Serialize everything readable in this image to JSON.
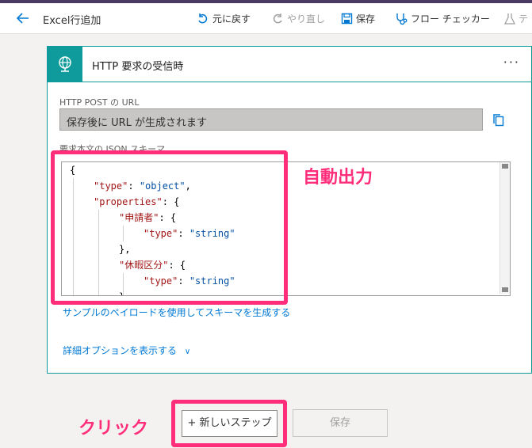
{
  "header": {
    "title": "Excel行追加",
    "undo_label": "元に戻す",
    "redo_label": "やり直し",
    "save_label": "保存",
    "checker_label": "フロー チェッカー",
    "test_label": "テ"
  },
  "card": {
    "title": "HTTP 要求の受信時",
    "more_label": "···",
    "url_label": "HTTP POST の URL",
    "url_value": "保存後に URL が生成されます",
    "schema_label": "要求本文の JSON スキーマ",
    "sample_link": "サンプルのペイロードを使用してスキーマを生成する",
    "advanced_link": "詳細オプションを表示する",
    "advanced_chevron": "∨"
  },
  "schema_code": {
    "l1": "{",
    "l2_key": "\"type\"",
    "l2_val": "\"object\"",
    "l3_key": "\"properties\"",
    "l4_key": "\"申請者\"",
    "l5_key": "\"type\"",
    "l5_val": "\"string\"",
    "l6": "},",
    "l7_key": "\"休暇区分\"",
    "l8_key": "\"type\"",
    "l8_val": "\"string\"",
    "l9": "}"
  },
  "annotations": {
    "auto_output": "自動出力",
    "click": "クリック"
  },
  "footer": {
    "new_step_label": "+ 新しいステップ",
    "save_label": "保存"
  },
  "colors": {
    "accent_teal": "#0f9b9b",
    "highlight_pink": "#ff2d7a",
    "link_blue": "#0078d4",
    "top_purple": "#4b3b62"
  },
  "icons": [
    "back-arrow-icon",
    "undo-icon",
    "redo-icon",
    "save-icon",
    "stethoscope-icon",
    "flask-icon",
    "globe-trigger-icon",
    "copy-icon"
  ]
}
